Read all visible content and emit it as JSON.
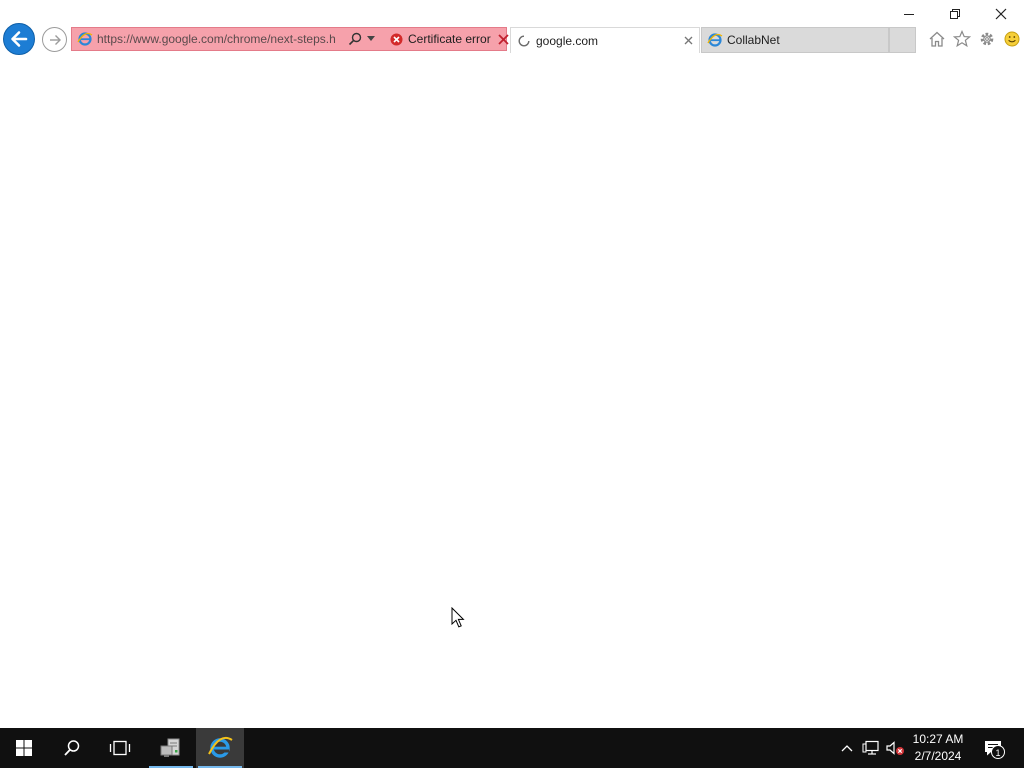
{
  "window": {
    "minimize_icon": "minimize-icon",
    "restore_icon": "restore-icon",
    "close_icon": "close-icon"
  },
  "nav": {
    "back_icon": "back-arrow-icon",
    "forward_icon": "forward-arrow-icon"
  },
  "address_bar": {
    "url": "https://www.google.com/chrome/next-steps.h",
    "certificate_status": "Certificate error",
    "background_color": "#f6a1ab",
    "favicon": "ie-page-icon",
    "search_icon": "search-icon",
    "dropdown_icon": "chevron-down-icon",
    "cert_icon": "error-icon",
    "close_icon": "close-icon"
  },
  "tabs": [
    {
      "label": "google.com",
      "active": true,
      "icon": "loading-spinner-icon"
    },
    {
      "label": "CollabNet",
      "active": false,
      "icon": "ie-page-icon"
    }
  ],
  "toolbar": {
    "icons": [
      "home-icon",
      "favorites-star-icon",
      "gear-icon",
      "smiley-feedback-icon"
    ]
  },
  "taskbar": {
    "start_icon": "windows-logo-icon",
    "search_icon": "search-icon",
    "task_view_icon": "task-view-icon",
    "pinned": [
      "server-manager-icon",
      "internet-explorer-icon"
    ],
    "tray_icons": [
      "chevron-up-icon",
      "network-icon",
      "volume-muted-icon"
    ],
    "clock_time": "10:27 AM",
    "clock_date": "2/7/2024",
    "notification_count": "1",
    "accent_color": "#76b9ed"
  }
}
